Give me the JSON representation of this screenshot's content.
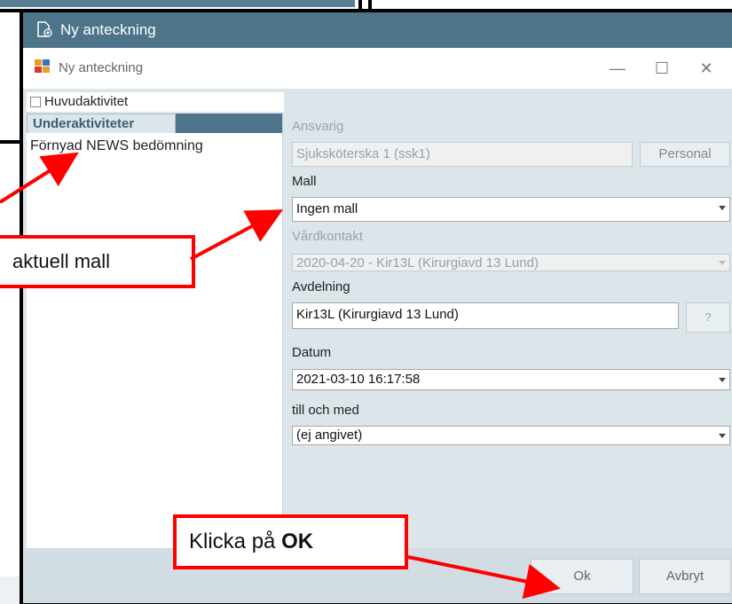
{
  "outer_title": "Ny anteckning",
  "dialog_title": "Ny anteckning",
  "window_controls": {
    "minimize": "—",
    "maximize": "☐",
    "close": "✕"
  },
  "main_activity_label": "Huvudaktivitet",
  "tab_label": "Underaktiviteter",
  "sub_activities": [
    "Förnyad NEWS bedömning"
  ],
  "form": {
    "ansvarig_label": "Ansvarig",
    "ansvarig_value": "Sjuksköterska 1 (ssk1)",
    "personal_button": "Personal",
    "mall_label": "Mall",
    "mall_value": "Ingen mall",
    "vardkontakt_label": "Vårdkontakt",
    "vardkontakt_value": "2020-04-20 -  Kir13L (Kirurgiavd 13 Lund)",
    "avdelning_label": "Avdelning",
    "avdelning_value": "Kir13L (Kirurgiavd 13 Lund)",
    "avdelning_help": "?",
    "datum_label": "Datum",
    "datum_value": "2021-03-10 16:17:58",
    "till_label": "till och med",
    "till_value": "(ej angivet)"
  },
  "buttons": {
    "ok": "Ok",
    "cancel": "Avbryt"
  },
  "callouts": {
    "mall": "aktuell mall",
    "ok_prefix": "Klicka på ",
    "ok_bold": "OK"
  },
  "colors": {
    "titlebar": "#4d7488",
    "annotation": "#ff0000",
    "panel": "#dbe5ea"
  }
}
